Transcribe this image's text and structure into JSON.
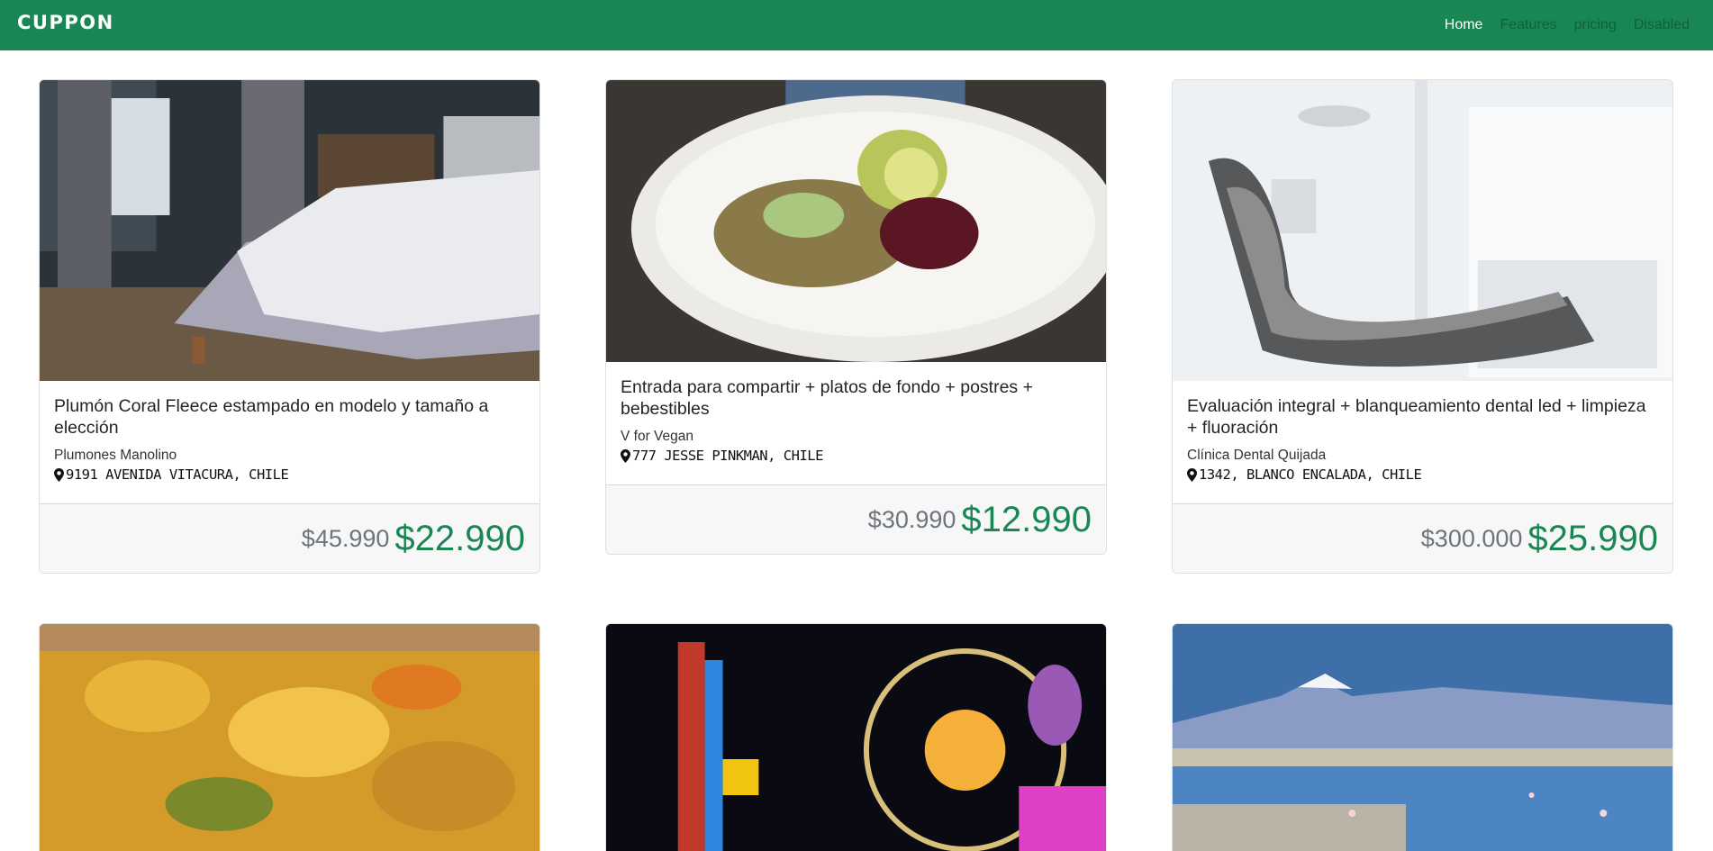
{
  "navbar": {
    "brand": "CUPPON",
    "links": [
      {
        "label": "Home",
        "active": true
      },
      {
        "label": "Features"
      },
      {
        "label": "pricing"
      },
      {
        "label": "Disabled"
      }
    ]
  },
  "cards": [
    {
      "title": "Plumón Coral Fleece estampado en modelo y tamaño a elección",
      "merchant": "Plumones Manolino",
      "address": "9191 AVENIDA VITACURA, CHILE",
      "old_price": "$45.990",
      "new_price": "$22.990",
      "image": "bedroom-photo"
    },
    {
      "title": "Entrada para compartir + platos de fondo + postres + bebestibles",
      "merchant": "V for Vegan",
      "address": "777 JESSE PINKMAN, CHILE",
      "old_price": "$30.990",
      "new_price": "$12.990",
      "image": "vegan-salad-photo"
    },
    {
      "title": "Evaluación integral + blanqueamiento dental led + limpieza + fluoración",
      "merchant": "Clínica Dental Quijada",
      "address": " 1342, BLANCO ENCALADA, CHILE",
      "old_price": "$300.000",
      "new_price": "$25.990",
      "image": "dental-chair-photo"
    },
    {
      "image": "food-closeup-photo"
    },
    {
      "image": "amusement-park-photo"
    },
    {
      "image": "flamingo-lake-photo"
    }
  ],
  "colors": {
    "brand": "#198754",
    "muted": "#6c757d"
  }
}
